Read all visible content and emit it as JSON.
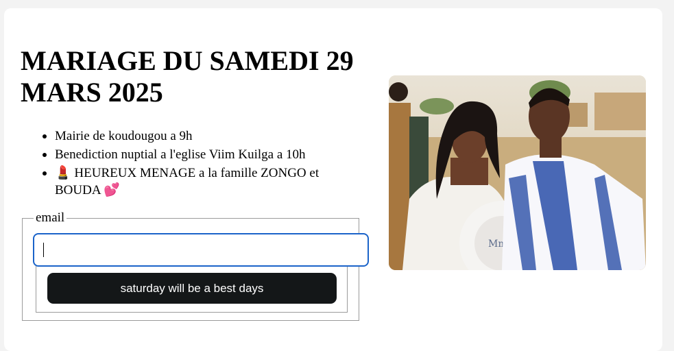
{
  "page": {
    "title": "MARIAGE DU SAMEDI 29 MARS 2025",
    "items": [
      "Mairie de koudougou a 9h",
      "Benediction nuptial a l'eglise Viim Kuilga a 10h",
      "💄 HEUREUX MENAGE a la famille ZONGO et BOUDA 💕"
    ]
  },
  "form": {
    "legend": "email",
    "email_value": "",
    "submit_label": "saturday will be a best days"
  },
  "photo": {
    "description_icon": "wedding-couple-photo",
    "fan_text": "Mme ZONGO"
  },
  "colors": {
    "input_border": "#1a63c9",
    "button_bg": "#141718",
    "button_text": "#ffffff"
  }
}
